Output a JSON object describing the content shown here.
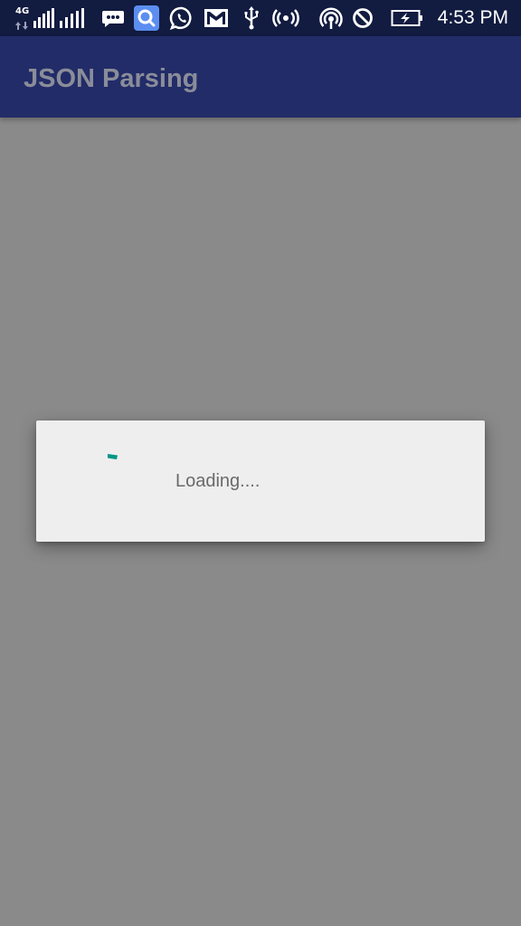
{
  "status_bar": {
    "network_type": "4G",
    "time": "4:53 PM",
    "background_color": "#121b40",
    "icons": [
      "signal-strength-icon",
      "signal-strength-2-icon",
      "messaging-icon",
      "search-app-icon",
      "whatsapp-icon",
      "gmail-icon",
      "usb-icon",
      "hotspot-icon",
      "wifi-calling-icon",
      "do-not-disturb-icon",
      "battery-charging-icon"
    ]
  },
  "app_bar": {
    "title": "JSON Parsing",
    "background_color": "#222c68"
  },
  "dialog": {
    "message": "Loading....",
    "spinner_color": "#009688",
    "background_color": "#eeeeee"
  },
  "scrim_color": "#8a8a8a"
}
